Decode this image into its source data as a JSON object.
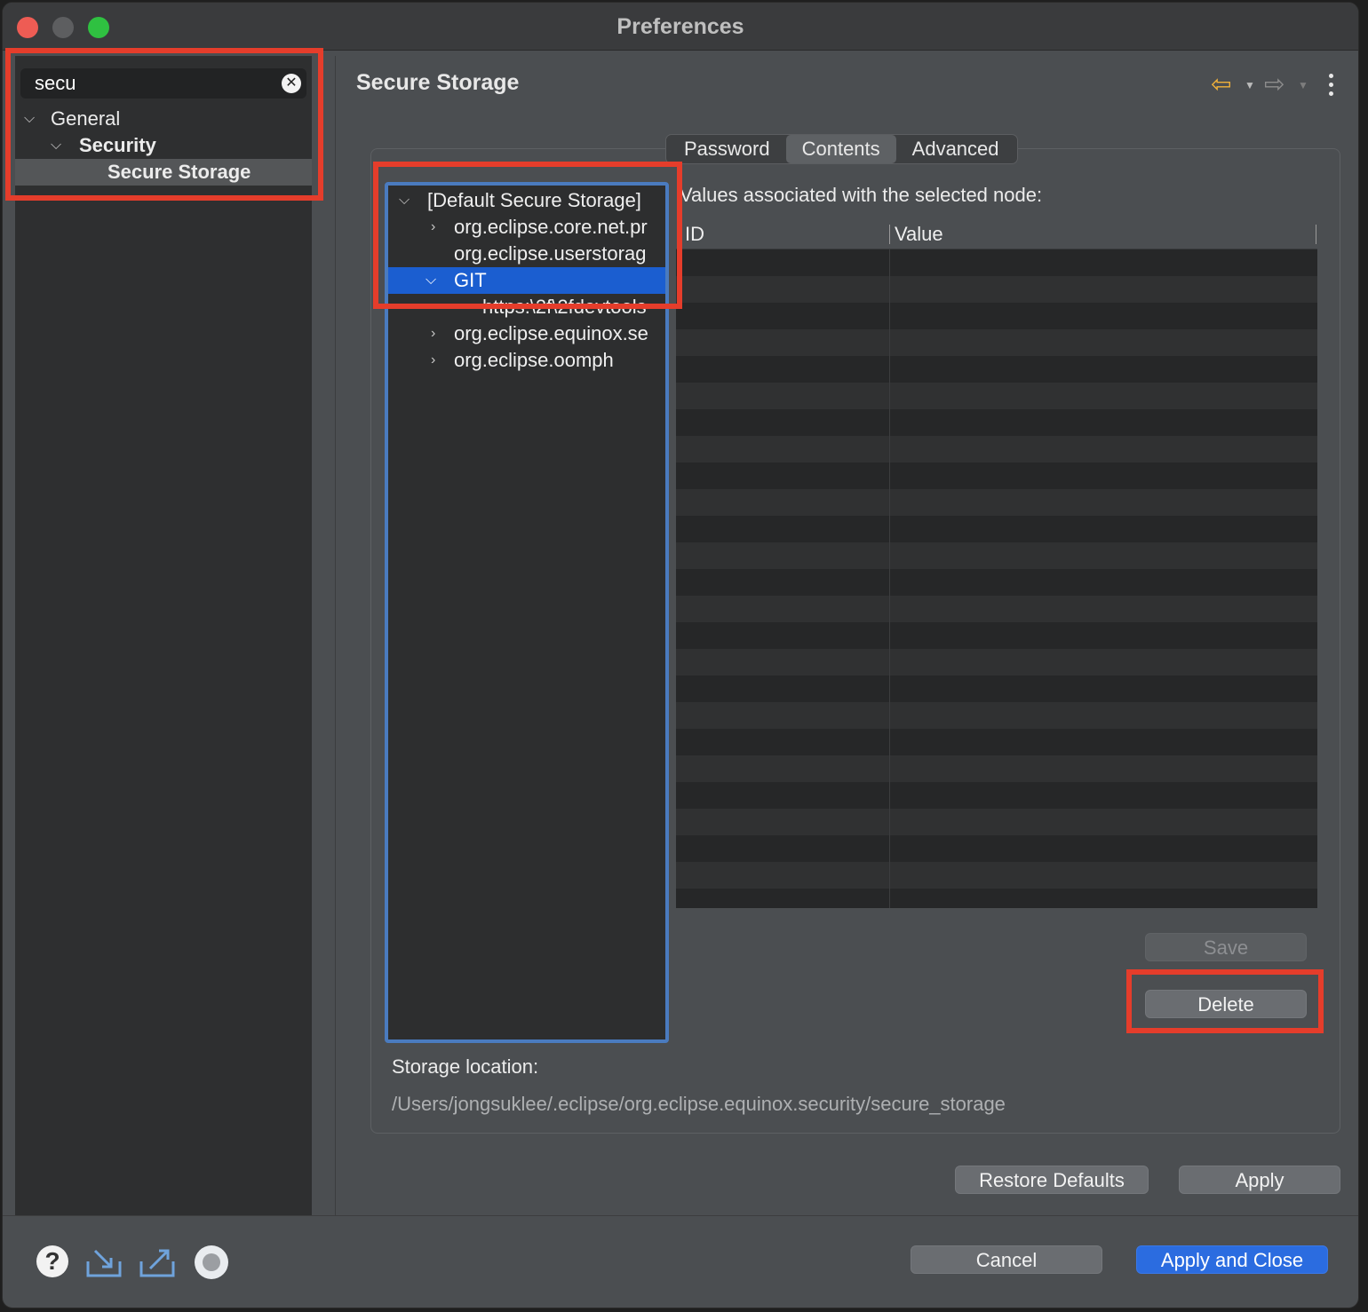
{
  "window": {
    "title": "Preferences"
  },
  "search": {
    "value": "secu"
  },
  "nav": {
    "items": [
      {
        "label": "General"
      },
      {
        "label": "Security"
      },
      {
        "label": "Secure Storage"
      }
    ]
  },
  "page": {
    "title": "Secure Storage"
  },
  "tabs": [
    {
      "label": "Password"
    },
    {
      "label": "Contents"
    },
    {
      "label": "Advanced"
    }
  ],
  "storage_tree": {
    "items": [
      {
        "label": "[Default Secure Storage]"
      },
      {
        "label": "org.eclipse.core.net.pr"
      },
      {
        "label": "org.eclipse.userstorag"
      },
      {
        "label": "GIT"
      },
      {
        "label": "https:\\2f\\2fdevtools"
      },
      {
        "label": "org.eclipse.equinox.se"
      },
      {
        "label": "org.eclipse.oomph"
      }
    ]
  },
  "values_table": {
    "label": "Values associated with the selected node:",
    "columns": [
      "ID",
      "Value"
    ]
  },
  "buttons": {
    "save": "Save",
    "delete": "Delete",
    "restore_defaults": "Restore Defaults",
    "apply": "Apply",
    "cancel": "Cancel",
    "apply_and_close": "Apply and Close"
  },
  "storage": {
    "label": "Storage location:",
    "path": "/Users/jongsuklee/.eclipse/org.eclipse.equinox.security/secure_storage"
  },
  "icons": {
    "help": "help-icon",
    "import": "import-icon",
    "export": "export-icon",
    "record": "record-icon",
    "back": "back-arrow-icon",
    "forward": "forward-arrow-icon",
    "menu": "view-menu-icon"
  },
  "colors": {
    "selection": "#1b5ed0",
    "annotation": "#e53d2b",
    "focus_border": "#4a7bbf",
    "primary_button": "#2b6ce0"
  }
}
